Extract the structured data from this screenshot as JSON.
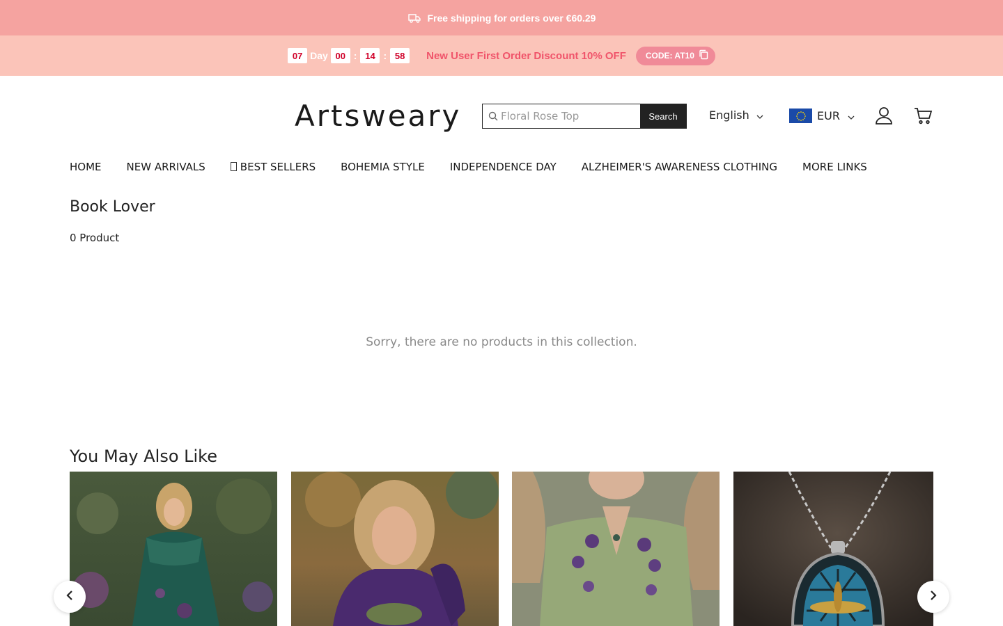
{
  "announcement": {
    "shipping_text": "Free shipping for orders over €60.29",
    "countdown": {
      "days": "07",
      "day_label": "Day",
      "hours": "00",
      "minutes": "14",
      "seconds": "58",
      "separator": ":"
    },
    "promo_text": "New User First Order Discount 10% OFF",
    "code_label": "CODE: AT10",
    "colors": {
      "shipping_bg": "#f5a3a0",
      "countdown_bg": "#fbc4b9",
      "promo_text": "#f0546a",
      "code_pill": "#f08a98"
    }
  },
  "header": {
    "logo_text": "Artsweary",
    "search": {
      "placeholder": "Floral Rose Top",
      "button_label": "Search"
    },
    "language": "English",
    "currency": "EUR"
  },
  "nav": {
    "items": [
      {
        "label": "HOME"
      },
      {
        "label": "NEW ARRIVALS"
      },
      {
        "label": "BEST SELLERS"
      },
      {
        "label": "BOHEMIA STYLE"
      },
      {
        "label": "INDEPENDENCE DAY"
      },
      {
        "label": "ALZHEIMER'S AWARENESS CLOTHING"
      },
      {
        "label": "MORE LINKS"
      }
    ]
  },
  "collection": {
    "title": "Book Lover",
    "product_count": "0 Product",
    "empty_message": "Sorry, there are no products in this collection."
  },
  "recommendations": {
    "title": "You May Also Like",
    "products": [
      {
        "image": "woman-green-floral-dress"
      },
      {
        "image": "woman-purple-hoodie"
      },
      {
        "image": "woman-green-embroidered-blouse"
      },
      {
        "image": "stained-glass-dragonfly-necklace"
      }
    ]
  }
}
